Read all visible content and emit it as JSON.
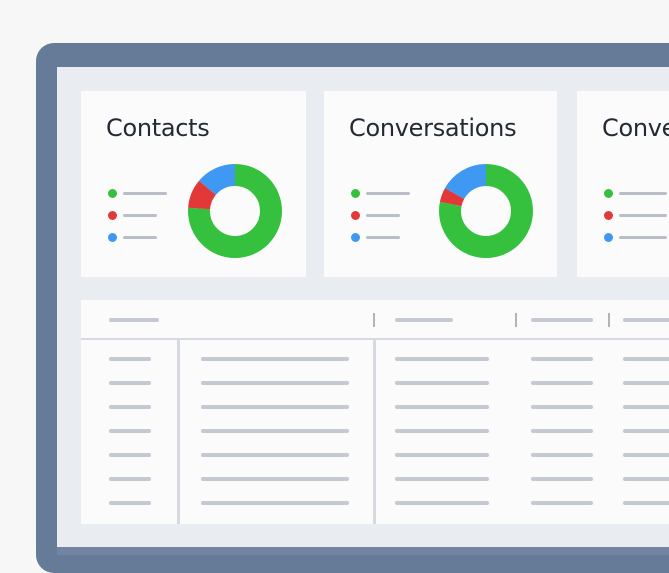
{
  "colors": {
    "frame": "#667b98",
    "screen": "#e9ecf1",
    "card": "#fbfbfc",
    "green": "#35c13e",
    "red": "#e23838",
    "blue": "#3f98f2",
    "placeholder_bar": "#c4c9d2"
  },
  "cards": [
    {
      "title": "Contacts",
      "legend": [
        {
          "color": "#35c13e",
          "icon": "green-dot"
        },
        {
          "color": "#e23838",
          "icon": "red-dot"
        },
        {
          "color": "#3f98f2",
          "icon": "blue-dot"
        }
      ],
      "donut": [
        {
          "label": "green",
          "value": 0.76,
          "color": "#35c13e"
        },
        {
          "label": "red",
          "value": 0.1,
          "color": "#e23838"
        },
        {
          "label": "blue",
          "value": 0.14,
          "color": "#3f98f2"
        }
      ]
    },
    {
      "title": "Conversations",
      "legend": [
        {
          "color": "#35c13e",
          "icon": "green-dot"
        },
        {
          "color": "#e23838",
          "icon": "red-dot"
        },
        {
          "color": "#3f98f2",
          "icon": "blue-dot"
        }
      ],
      "donut": [
        {
          "label": "green",
          "value": 0.78,
          "color": "#35c13e"
        },
        {
          "label": "red",
          "value": 0.05,
          "color": "#e23838"
        },
        {
          "label": "blue",
          "value": 0.17,
          "color": "#3f98f2"
        }
      ]
    },
    {
      "title": "Conve",
      "legend": [
        {
          "color": "#35c13e",
          "icon": "green-dot"
        },
        {
          "color": "#e23838",
          "icon": "red-dot"
        },
        {
          "color": "#3f98f2",
          "icon": "blue-dot"
        }
      ]
    }
  ],
  "table": {
    "row_count": 7
  }
}
